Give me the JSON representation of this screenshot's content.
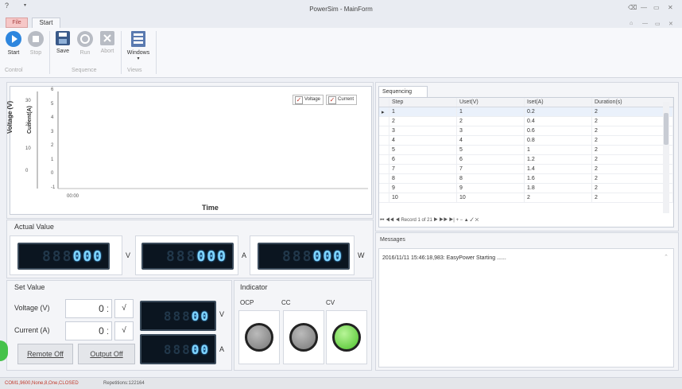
{
  "window": {
    "title": "PowerSim - MainForm",
    "menu_q": "?",
    "menu_arrow": "▾",
    "controls": [
      "⌫",
      "—",
      "▭",
      "✕"
    ],
    "sub_controls": [
      "⌂",
      "—",
      "▭",
      "✕"
    ]
  },
  "tabs": {
    "file": "File",
    "start": "Start"
  },
  "ribbon": {
    "buttons": [
      {
        "label": "Start",
        "icon": "play-icon",
        "color": "#2e86de",
        "enabled": true
      },
      {
        "label": "Stop",
        "icon": "stop-icon",
        "color": "#b8bcc4",
        "enabled": false
      },
      {
        "label": "Save",
        "icon": "save-icon",
        "color": "#3a5a8a",
        "enabled": true
      },
      {
        "label": "Run",
        "icon": "run-icon",
        "color": "#b8bcc4",
        "enabled": false
      },
      {
        "label": "Abort",
        "icon": "abort-icon",
        "color": "#b8bcc4",
        "enabled": false
      },
      {
        "label": "Windows",
        "icon": "windows-icon",
        "color": "#5a7ab0",
        "enabled": true
      }
    ],
    "groups": [
      "Control",
      "Sequence",
      "Views"
    ]
  },
  "chart_data": {
    "type": "line",
    "series": [
      {
        "name": "Voltage",
        "values": []
      },
      {
        "name": "Current",
        "values": []
      }
    ],
    "y1_label": "Voltage (V)",
    "y1_ticks": [
      "30",
      "20",
      "10",
      "0"
    ],
    "y2_label": "Current(A)",
    "y2_ticks": [
      "6",
      "5",
      "4",
      "3",
      "2",
      "1",
      "0",
      "-1"
    ],
    "x_ticks": [
      "00:00"
    ],
    "xlabel": "Time",
    "legend": "top-right"
  },
  "actual_value": {
    "title": "Actual Value",
    "voltage": {
      "ghost": "888",
      "value": "000",
      "unit": "V"
    },
    "current": {
      "ghost": "888",
      "value": "000",
      "unit": "A"
    },
    "power": {
      "ghost": "888",
      "value": "000",
      "unit": "W"
    }
  },
  "set_value": {
    "title": "Set Value",
    "voltage_label": "Voltage (V)",
    "current_label": "Current (A)",
    "voltage_input": "0",
    "current_input": "0",
    "spin_glyph": "⁚",
    "check_glyph": "√",
    "voltage_lcd": {
      "ghost": "888",
      "value": "00",
      "unit": "V"
    },
    "current_lcd": {
      "ghost": "888",
      "value": "00",
      "unit": "A"
    },
    "remote_off": "Remote Off",
    "output_off": "Output Off"
  },
  "indicator": {
    "title": "Indicator",
    "items": [
      {
        "label": "OCP",
        "color": "#8a8a8a"
      },
      {
        "label": "CC",
        "color": "#8a8a8a"
      },
      {
        "label": "CV",
        "color": "#6fd63a"
      }
    ]
  },
  "sequencing": {
    "tab": "Sequencing",
    "columns": [
      "Step",
      "Uset(V)",
      "Iset(A)",
      "Duration(s)"
    ],
    "rows": [
      [
        "1",
        "1",
        "0.2",
        "2"
      ],
      [
        "2",
        "2",
        "0.4",
        "2"
      ],
      [
        "3",
        "3",
        "0.6",
        "2"
      ],
      [
        "4",
        "4",
        "0.8",
        "2"
      ],
      [
        "5",
        "5",
        "1",
        "2"
      ],
      [
        "6",
        "6",
        "1.2",
        "2"
      ],
      [
        "7",
        "7",
        "1.4",
        "2"
      ],
      [
        "8",
        "8",
        "1.6",
        "2"
      ],
      [
        "9",
        "9",
        "1.8",
        "2"
      ],
      [
        "10",
        "10",
        "2",
        "2"
      ]
    ],
    "navigator": "⏮ ◀◀ ◀  Record 1 of 21  ▶ ▶▶ ▶| + − ▲ ✓ ✕"
  },
  "messages": {
    "title": "Messages",
    "lines": [
      "2016/11/11 15:46:18,983: EasyPower Starting ......"
    ]
  },
  "status": {
    "connection": "COM1,9600,None,8,One,CLOSED",
    "repetitions": "Repetitions:122164",
    "connection_color": "#c0392b"
  }
}
